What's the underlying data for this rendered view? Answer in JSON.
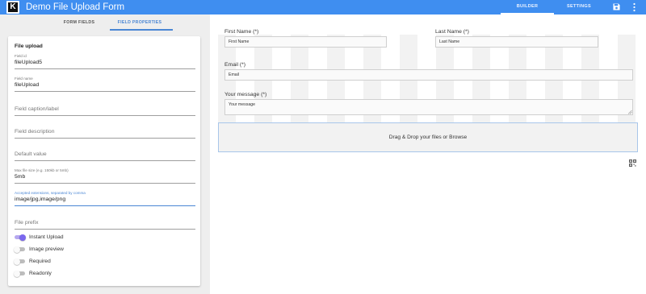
{
  "app": {
    "title": "Demo File Upload Form",
    "logo_letter": "K",
    "tabs": {
      "builder": "BUILDER",
      "settings": "SETTINGS"
    },
    "icons": {
      "save": "save-icon",
      "more": "more-vert-icon"
    },
    "accent_color": "#3f8ef0"
  },
  "sidebar": {
    "tabs": {
      "form_fields": "FORM FIELDS",
      "field_properties": "FIELD PROPERTIES"
    },
    "active_tab": "field_properties",
    "card_title": "File upload",
    "fields": {
      "field_id": {
        "label": "Field id",
        "value": "fileUpload5"
      },
      "field_name": {
        "label": "Field name",
        "value": "fileUpload"
      },
      "caption": {
        "placeholder": "Field caption/label"
      },
      "description": {
        "placeholder": "Field description"
      },
      "default_value": {
        "placeholder": "Default value"
      },
      "max_size": {
        "label": "Max file size (e.g. 150kb or 5mb)",
        "value": "5mb"
      },
      "extensions": {
        "label": "Accepted extensions, separated by comma",
        "value": "image/jpg,image/png"
      },
      "file_prefix": {
        "placeholder": "File prefix"
      }
    },
    "toggles": [
      {
        "label": "Instant Upload",
        "on": true
      },
      {
        "label": "Image preview",
        "on": false
      },
      {
        "label": "Required",
        "on": false
      },
      {
        "label": "Readonly",
        "on": false
      }
    ]
  },
  "canvas": {
    "first_name": {
      "label": "First Name (*)",
      "placeholder": "First Name"
    },
    "last_name": {
      "label": "Last Name (*)",
      "placeholder": "Last Name"
    },
    "email": {
      "label": "Email (*)",
      "placeholder": "Email"
    },
    "message": {
      "label": "Your message (*)",
      "placeholder": "Your message"
    },
    "dropzone": {
      "text": "Drag & Drop your files or Browse"
    },
    "icons": {
      "qr": "qr-code-icon",
      "resize": "resize-handle-icon"
    }
  }
}
